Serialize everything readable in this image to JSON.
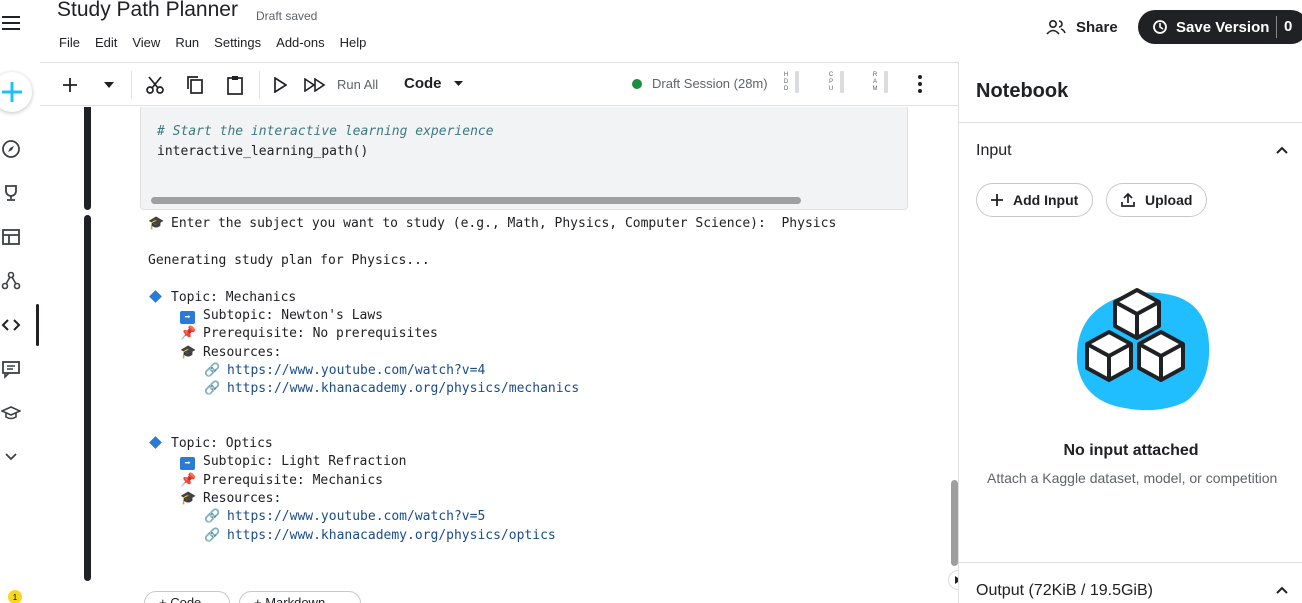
{
  "app": {
    "title": "Study Path Planner",
    "draft_status": "Draft saved",
    "menu": [
      "File",
      "Edit",
      "View",
      "Run",
      "Settings",
      "Add-ons",
      "Help"
    ],
    "share_label": "Share",
    "save_label": "Save Version",
    "save_count": "0"
  },
  "toolbar": {
    "run_all_label": "Run All",
    "cell_type": "Code",
    "session_label": "Draft Session (28m)",
    "meters": [
      "HDD",
      "CPU",
      "RAM"
    ],
    "status_color": "#1e8e3e"
  },
  "code_cell": {
    "comment": "# Start the interactive learning experience",
    "line": "interactive_learning_path()"
  },
  "output": {
    "prompt_text": "Enter the subject you want to study (e.g., Math, Physics, Computer Science):  Physics",
    "generating": "Generating study plan for Physics...",
    "topics": [
      {
        "topic": "Topic: Mechanics",
        "subtopic": "Subtopic: Newton's Laws",
        "prerequisite": "Prerequisite: No prerequisites",
        "resources_label": "Resources:",
        "links": [
          "https://www.youtube.com/watch?v=4",
          "https://www.khanacademy.org/physics/mechanics"
        ]
      },
      {
        "topic": "Topic: Optics",
        "subtopic": "Subtopic: Light Refraction",
        "prerequisite": "Prerequisite: Mechanics",
        "resources_label": "Resources:",
        "links": [
          "https://www.youtube.com/watch?v=5",
          "https://www.khanacademy.org/physics/optics"
        ]
      }
    ]
  },
  "add_cell_buttons": [
    "+ Code",
    "+ Markdown"
  ],
  "panel": {
    "title": "Notebook",
    "input_section": "Input",
    "add_input_label": "Add Input",
    "upload_label": "Upload",
    "empty_title": "No input attached",
    "empty_desc": "Attach a Kaggle dataset, model, or competition",
    "output_section": "Output (72KiB / 19.5GiB)"
  },
  "notification_count": "1"
}
